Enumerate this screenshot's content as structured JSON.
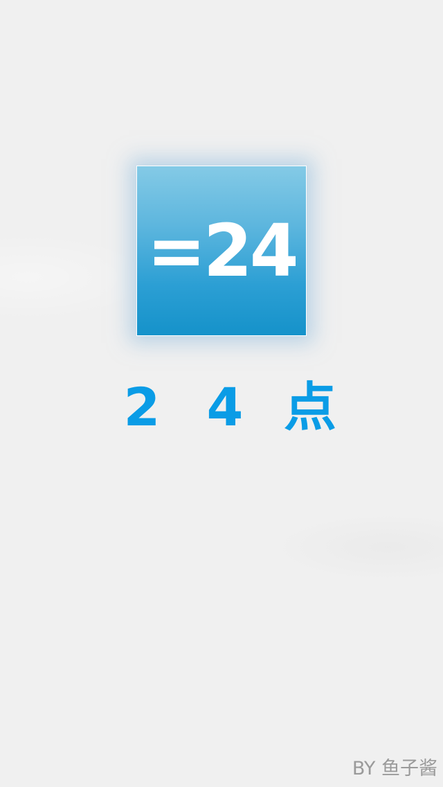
{
  "splash": {
    "icon_text": "=24",
    "title_chars": [
      "2",
      "4",
      "点"
    ],
    "credit": "BY 鱼子酱"
  },
  "colors": {
    "background": "#f0f0f0",
    "icon_top": "#84cae6",
    "icon_bottom": "#1592ca",
    "title_blue": "#0a9ce6",
    "credit_gray": "#9a9a9a"
  }
}
